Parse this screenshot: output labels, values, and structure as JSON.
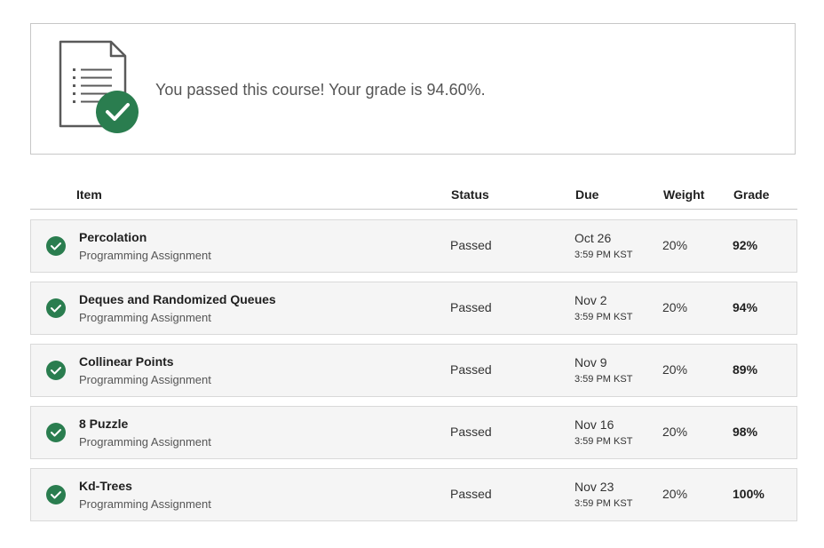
{
  "banner": {
    "message": "You passed this course! Your grade is 94.60%.",
    "icon": "document-checked-icon",
    "accent_color": "#2a7d4f"
  },
  "table": {
    "headers": {
      "item": "Item",
      "status": "Status",
      "due": "Due",
      "weight": "Weight",
      "grade": "Grade"
    },
    "rows": [
      {
        "title": "Percolation",
        "type": "Programming Assignment",
        "status": "Passed",
        "due_date": "Oct 26",
        "due_time": "3:59 PM KST",
        "weight": "20%",
        "grade": "92%"
      },
      {
        "title": "Deques and Randomized Queues",
        "type": "Programming Assignment",
        "status": "Passed",
        "due_date": "Nov 2",
        "due_time": "3:59 PM KST",
        "weight": "20%",
        "grade": "94%"
      },
      {
        "title": "Collinear Points",
        "type": "Programming Assignment",
        "status": "Passed",
        "due_date": "Nov 9",
        "due_time": "3:59 PM KST",
        "weight": "20%",
        "grade": "89%"
      },
      {
        "title": "8 Puzzle",
        "type": "Programming Assignment",
        "status": "Passed",
        "due_date": "Nov 16",
        "due_time": "3:59 PM KST",
        "weight": "20%",
        "grade": "98%"
      },
      {
        "title": "Kd-Trees",
        "type": "Programming Assignment",
        "status": "Passed",
        "due_date": "Nov 23",
        "due_time": "3:59 PM KST",
        "weight": "20%",
        "grade": "100%"
      }
    ]
  }
}
